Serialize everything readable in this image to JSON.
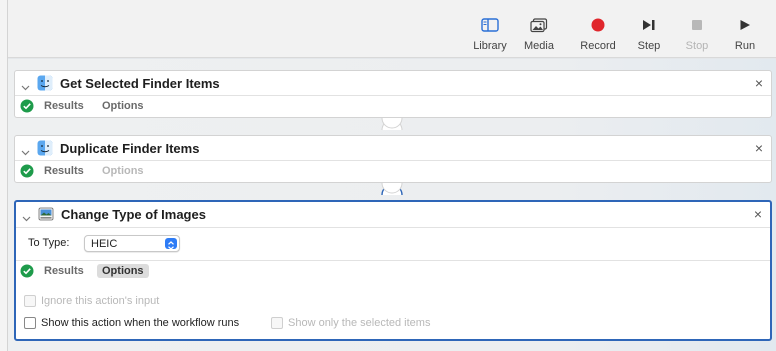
{
  "toolbar": {
    "library_label": "Library",
    "media_label": "Media",
    "record_label": "Record",
    "step_label": "Step",
    "stop_label": "Stop",
    "run_label": "Run"
  },
  "actions": [
    {
      "title": "Get Selected Finder Items",
      "tabs": {
        "results": "Results",
        "options": "Options"
      },
      "close": "×"
    },
    {
      "title": "Duplicate Finder Items",
      "tabs": {
        "results": "Results",
        "options": "Options"
      },
      "close": "×"
    },
    {
      "title": "Change Type of Images",
      "to_type_label": "To Type:",
      "to_type_value": "HEIC",
      "tabs": {
        "results": "Results",
        "options": "Options"
      },
      "close": "×",
      "ignore_input_label": "Ignore this action's input",
      "show_action_label": "Show this action when the workflow runs",
      "show_selected_label": "Show only the selected items"
    }
  ],
  "colors": {
    "accent": "#2e66b8",
    "record": "#e0262c",
    "success": "#1e9b4b",
    "popup_blue": "#2e7cf6"
  }
}
